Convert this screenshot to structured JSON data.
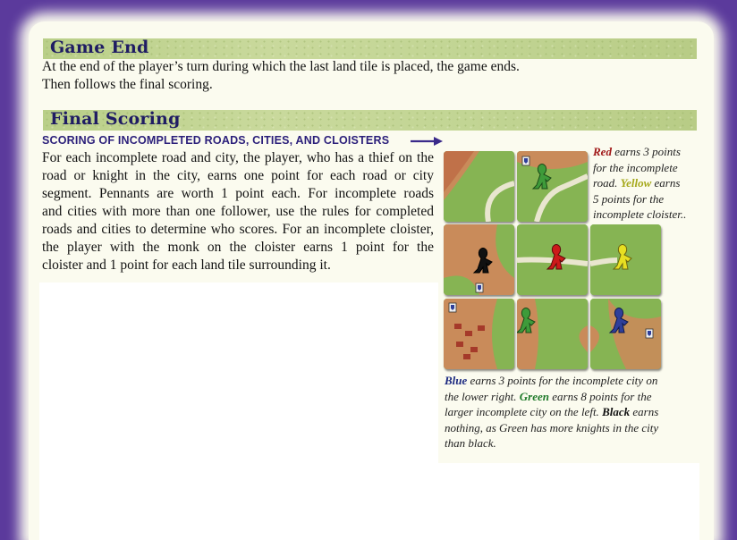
{
  "game_end": {
    "title": "Game End",
    "line1": "At the end of the player’s turn during which the last land tile is placed, the game ends.",
    "line2": "Then follows the final scoring."
  },
  "final_scoring": {
    "title": "Final Scoring",
    "subheading": "SCORING OF INCOMPLETED ROADS, CITIES, AND CLOISTERS",
    "lines": [
      "For each incomplete road and city, the player, who has a thief on the",
      "road or knight in the city, earns one point for each road or city",
      "segment. Pennants are worth 1 point each. For incomplete roads",
      "and cities with more than one follower, use the rules for completed",
      "roads and cities to determine who scores. For an incomplete cloister,",
      "the player with the monk on the cloister earns 1 point for the",
      "cloister and 1 point for each land tile surrounding it."
    ]
  },
  "caption_top": {
    "red": "Red",
    "red_rest_1": " earns 3 points",
    "line2": "for the incomplete",
    "line3_a": "road. ",
    "yellow": "Yellow",
    "line3_b": " earns",
    "line4": "5 points for the",
    "line5": "incomplete cloister.."
  },
  "caption_bottom": {
    "blue": "Blue",
    "line1_rest": " earns 3 points for the incomplete city on",
    "line2_a": "the lower right. ",
    "green": "Green",
    "line2_b": " earns 8 points for the",
    "line3_a": "larger incomplete city on the left. ",
    "black": "Black",
    "line3_b": " earns",
    "line4": "nothing, as Green has more knights in the city",
    "line5": "than black."
  },
  "meeples": [
    {
      "color": "#3e9b3a",
      "name": "green"
    },
    {
      "color": "#111111",
      "name": "black"
    },
    {
      "color": "#cc1a1a",
      "name": "red"
    },
    {
      "color": "#e8df22",
      "name": "yellow"
    },
    {
      "color": "#3e9b3a",
      "name": "green"
    },
    {
      "color": "#2f3f9a",
      "name": "blue"
    }
  ]
}
